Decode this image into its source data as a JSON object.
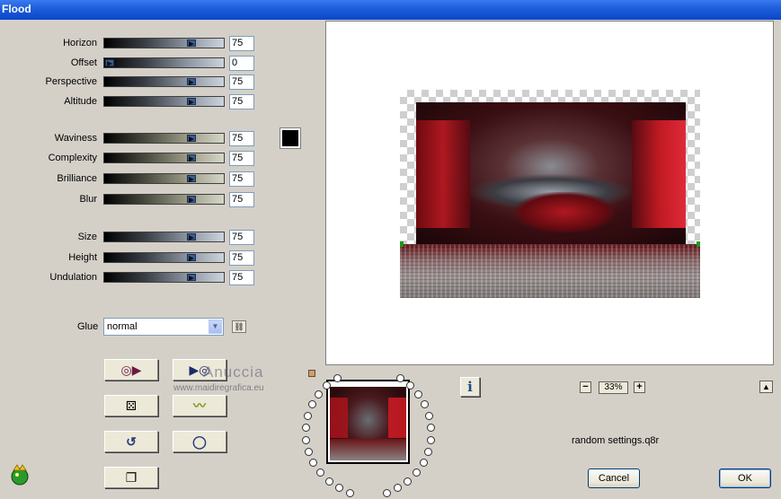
{
  "window": {
    "title": "Flood"
  },
  "sliders": {
    "group1": [
      {
        "label": "Horizon",
        "value": "75",
        "level": 0.75
      },
      {
        "label": "Offset",
        "value": "0",
        "level": 0.0
      },
      {
        "label": "Perspective",
        "value": "75",
        "level": 0.75
      },
      {
        "label": "Altitude",
        "value": "75",
        "level": 0.75
      }
    ],
    "group2": [
      {
        "label": "Waviness",
        "value": "75",
        "level": 0.75
      },
      {
        "label": "Complexity",
        "value": "75",
        "level": 0.75
      },
      {
        "label": "Brilliance",
        "value": "75",
        "level": 0.75
      },
      {
        "label": "Blur",
        "value": "75",
        "level": 0.75
      }
    ],
    "group3": [
      {
        "label": "Size",
        "value": "75",
        "level": 0.75
      },
      {
        "label": "Height",
        "value": "75",
        "level": 0.75
      },
      {
        "label": "Undulation",
        "value": "75",
        "level": 0.75
      }
    ]
  },
  "color_swatch": "#000000",
  "glue": {
    "label": "Glue",
    "value": "normal"
  },
  "zoom": {
    "value": "33%"
  },
  "settings": {
    "name": "random settings.q8r"
  },
  "buttons": {
    "cancel": "Cancel",
    "ok": "OK"
  },
  "watermark": {
    "line1": "Anuccia",
    "line2": "www.maidiregrafica.eu"
  }
}
